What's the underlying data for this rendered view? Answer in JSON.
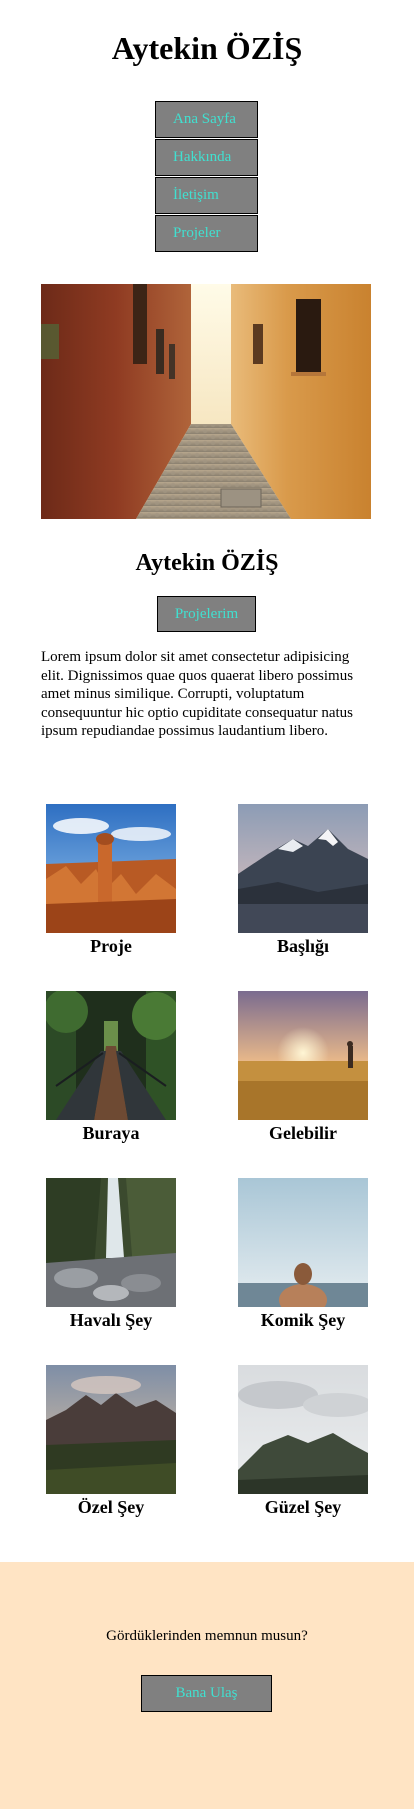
{
  "header": {
    "title": "Aytekin ÖZİŞ"
  },
  "nav": {
    "items": [
      {
        "label": "Ana Sayfa"
      },
      {
        "label": "Hakkında"
      },
      {
        "label": "İletişim"
      },
      {
        "label": "Projeler"
      }
    ]
  },
  "intro": {
    "name": "Aytekin ÖZİŞ",
    "button_label": "Projelerim",
    "paragraph": "Lorem ipsum dolor sit amet consectetur adipisicing elit. Dignissimos quae quos quaerat libero possimus amet minus similique. Corrupti, voluptatum consequuntur hic optio cupiditate consequatur natus ipsum repudiandae possimus laudantium libero."
  },
  "projects": [
    {
      "label": "Proje"
    },
    {
      "label": "Başlığı"
    },
    {
      "label": "Buraya"
    },
    {
      "label": "Gelebilir"
    },
    {
      "label": "Havalı Şey"
    },
    {
      "label": "Komik Şey"
    },
    {
      "label": "Özel Şey"
    },
    {
      "label": "Güzel Şey"
    }
  ],
  "footer": {
    "text": "Gördüklerinden memnun musun?",
    "button_label": "Bana Ulaş"
  },
  "colors": {
    "button_bg": "#808080",
    "button_text": "#40e0d0",
    "footer_bg": "#ffe4c4"
  }
}
